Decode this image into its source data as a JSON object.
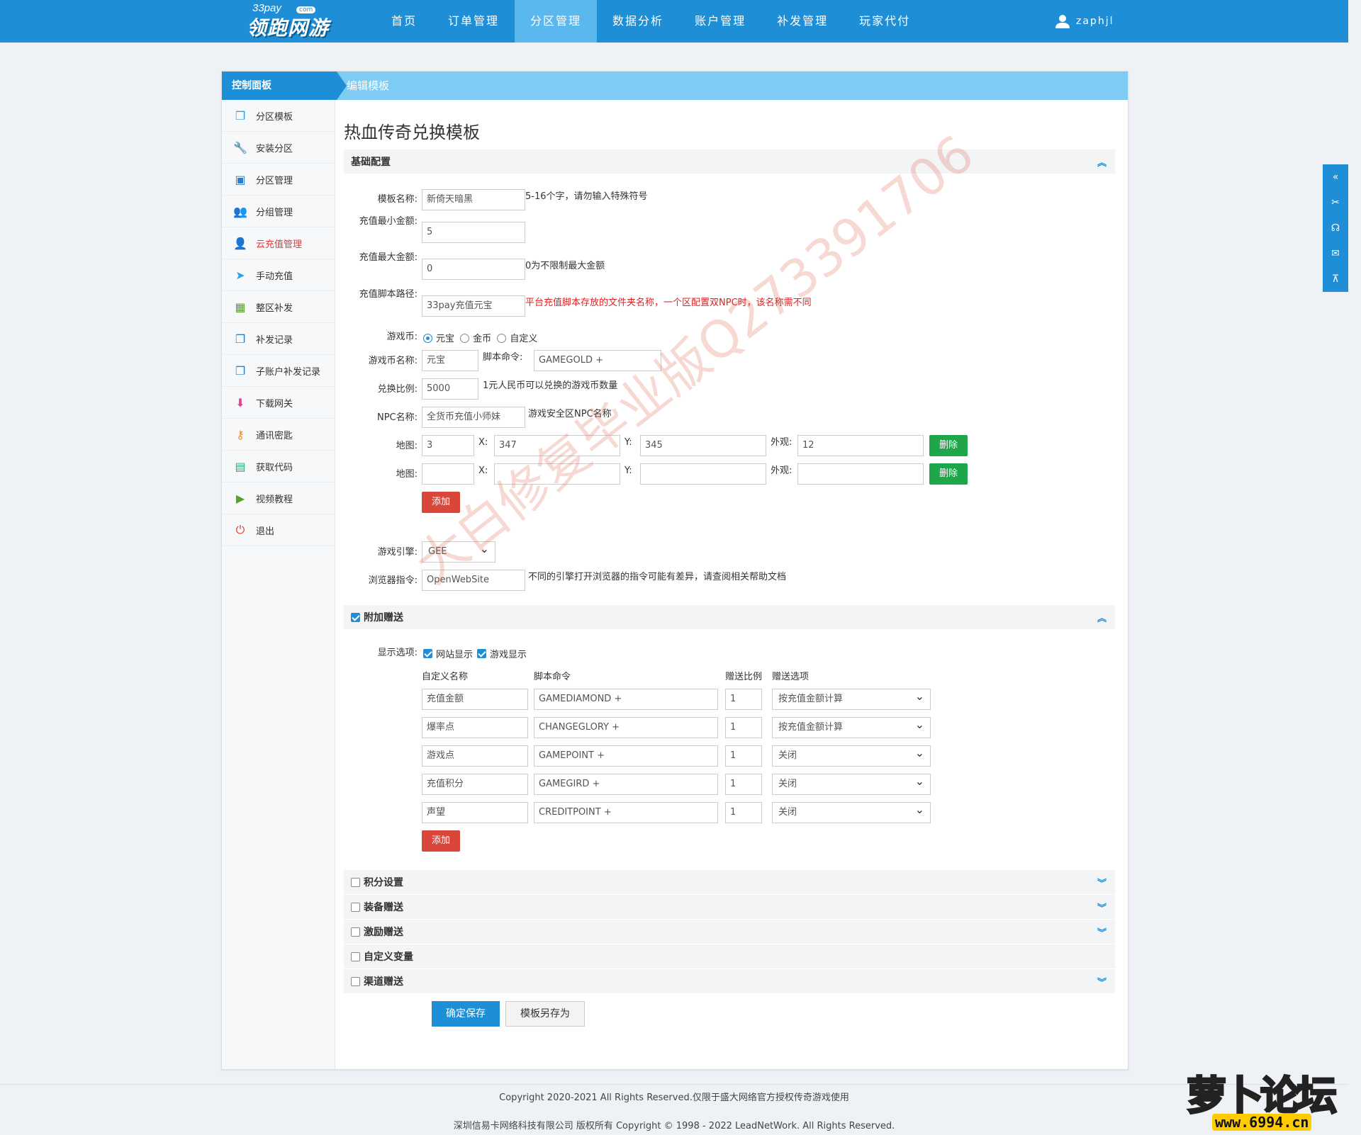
{
  "topbar": {
    "brand_small": "33pay",
    "brand_com": "com",
    "brand_main": "领跑网游",
    "nav": [
      "首页",
      "订单管理",
      "分区管理",
      "数据分析",
      "账户管理",
      "补发管理",
      "玩家代付"
    ],
    "active_nav": "分区管理",
    "user": "zaphjl"
  },
  "panel": {
    "control_panel": "控制面板",
    "edit_template": "编辑模板"
  },
  "sidebar": {
    "items": [
      {
        "label": "分区模板",
        "icon": "copy-icon"
      },
      {
        "label": "安装分区",
        "icon": "wrench-icon"
      },
      {
        "label": "分区管理",
        "icon": "inbox-icon"
      },
      {
        "label": "分组管理",
        "icon": "users-icon"
      },
      {
        "label": "云充值管理",
        "icon": "user-icon"
      },
      {
        "label": "手动充值",
        "icon": "send-icon"
      },
      {
        "label": "整区补发",
        "icon": "calendar-icon"
      },
      {
        "label": "补发记录",
        "icon": "copy-icon"
      },
      {
        "label": "子账户补发记录",
        "icon": "copy-icon"
      },
      {
        "label": "下载网关",
        "icon": "download-icon"
      },
      {
        "label": "通讯密匙",
        "icon": "key-icon"
      },
      {
        "label": "获取代码",
        "icon": "briefcase-icon"
      },
      {
        "label": "视频教程",
        "icon": "video-icon"
      },
      {
        "label": "退出",
        "icon": "power-icon"
      }
    ],
    "active": "云充值管理"
  },
  "content": {
    "title": "热血传奇兑换模板",
    "basic_section": "基础配置",
    "fields": {
      "template_name_label": "模板名称:",
      "template_name_value": "新倚天暗黑",
      "template_name_hint": "5-16个字，请勿输入特殊符号",
      "min_label": "充值最小金额:",
      "min_value": "5",
      "max_label": "充值最大金额:",
      "max_value": "0",
      "max_hint": "0为不限制最大金额",
      "script_label": "充值脚本路径:",
      "script_value": "33pay充值元宝",
      "script_hint": "平台充值脚本存放的文件夹名称，一个区配置双NPC时，该名称需不同",
      "currency_label": "游戏币:",
      "currency_options": [
        "元宝",
        "金币",
        "自定义"
      ],
      "currency_selected": "元宝",
      "currency_name_label": "游戏币名称:",
      "currency_name_value": "元宝",
      "script_cmd_label": "脚本命令:",
      "script_cmd_value": "GAMEGOLD +",
      "ratio_label": "兑换比例:",
      "ratio_value": "5000",
      "ratio_hint": "1元人民币可以兑换的游戏币数量",
      "npc_label": "NPC名称:",
      "npc_value": "全货币充值小师妹",
      "npc_hint": "游戏安全区NPC名称",
      "map_label": "地图:",
      "x_label": "X:",
      "y_label": "Y:",
      "look_label": "外观:",
      "maps": [
        {
          "map": "3",
          "x": "347",
          "y": "345",
          "look": "12"
        },
        {
          "map": "",
          "x": "",
          "y": "",
          "look": ""
        }
      ],
      "delete_label": "删除",
      "add_label": "添加",
      "engine_label": "游戏引擎:",
      "engine_value": "GEE",
      "browser_label": "浏览器指令:",
      "browser_value": "OpenWebSite",
      "browser_hint": "不同的引擎打开浏览器的指令可能有差异，请查阅相关帮助文档"
    },
    "bonus_section": "附加赠送",
    "bonus": {
      "display_label": "显示选项:",
      "show_site": "网站显示",
      "show_game": "游戏显示",
      "col_name": "自定义名称",
      "col_cmd": "脚本命令",
      "col_ratio": "赠送比例",
      "col_option": "赠送选项",
      "rows": [
        {
          "name": "充值金额",
          "cmd": "GAMEDIAMOND +",
          "ratio": "1",
          "option": "按充值金额计算"
        },
        {
          "name": "爆率点",
          "cmd": "CHANGEGLORY +",
          "ratio": "1",
          "option": "按充值金额计算"
        },
        {
          "name": "游戏点",
          "cmd": "GAMEPOINT +",
          "ratio": "1",
          "option": "关闭"
        },
        {
          "name": "充值积分",
          "cmd": "GAMEGIRD +",
          "ratio": "1",
          "option": "关闭"
        },
        {
          "name": "声望",
          "cmd": "CREDITPOINT +",
          "ratio": "1",
          "option": "关闭"
        }
      ],
      "add_label": "添加"
    },
    "collapsed_sections": [
      "积分设置",
      "装备赠送",
      "激励赠送",
      "自定义变量",
      "渠道赠送"
    ],
    "save_label": "确定保存",
    "save_as_label": "模板另存为"
  },
  "footer": {
    "line1": "Copyright 2020-2021 All Rights Reserved.仅限于盛大网络官方授权传奇游戏使用",
    "line2": "深圳信易卡网络科技有限公司 版权所有 Copyright © 1998 - 2022 LeadNetWork. All Rights Reserved."
  },
  "watermark": "大白修复毕业版Q273391706",
  "forum_logo": {
    "text": "萝卜论坛",
    "url": "www.6994.cn"
  }
}
